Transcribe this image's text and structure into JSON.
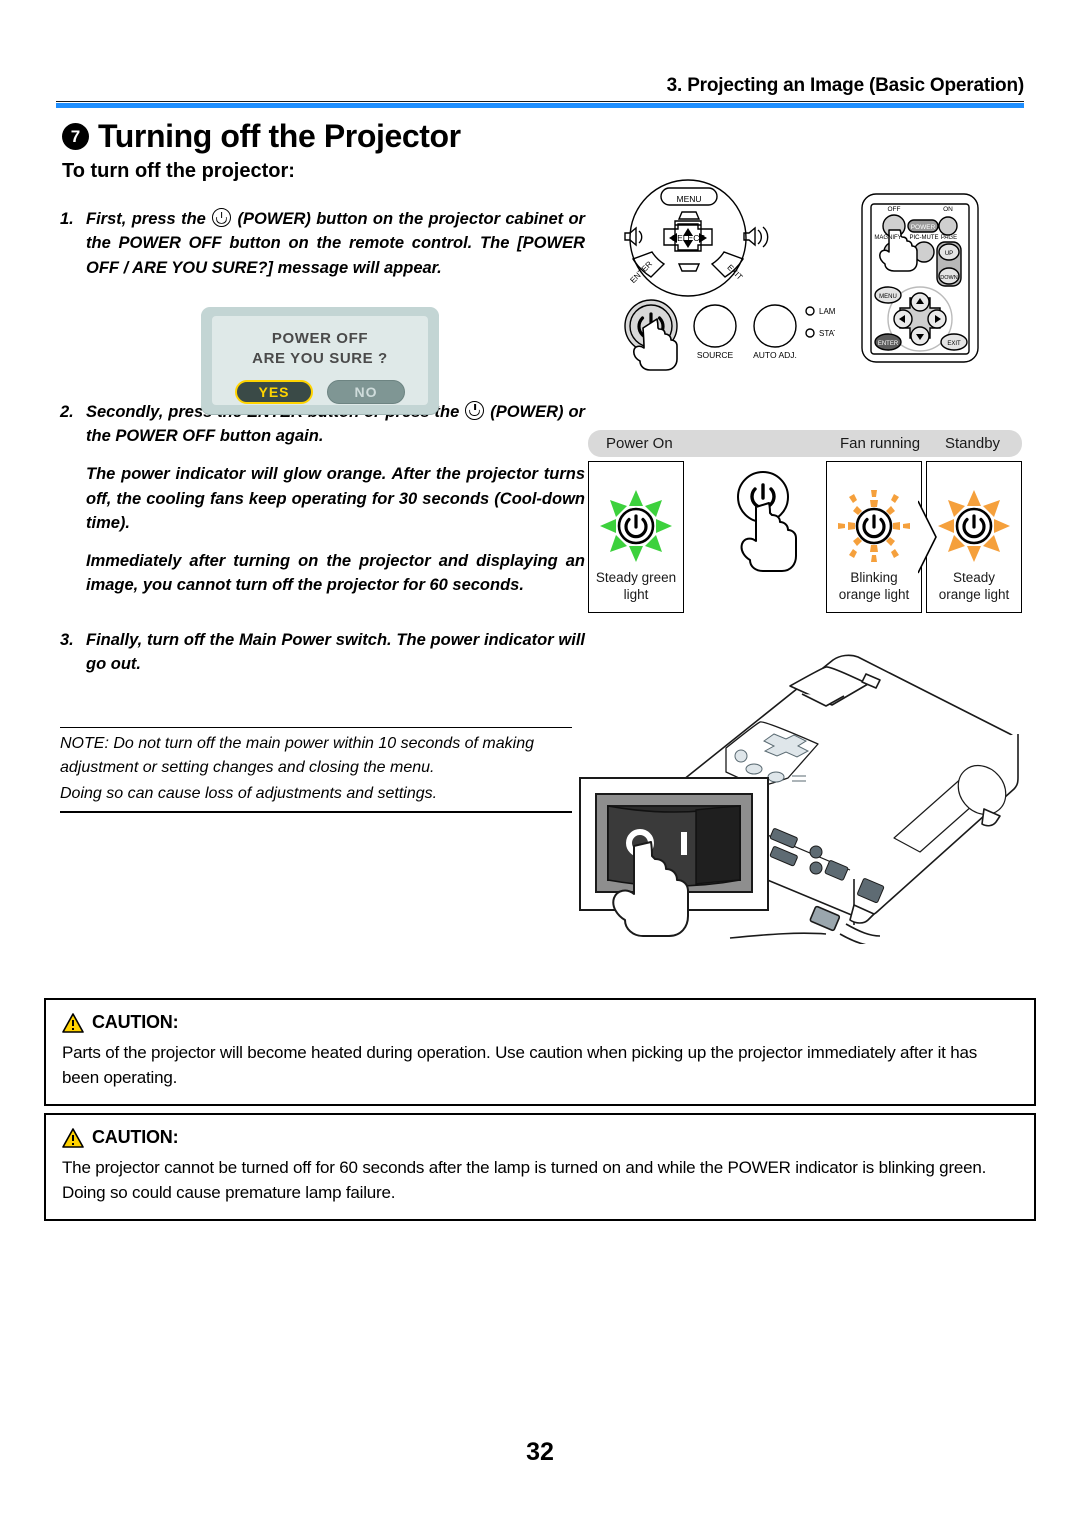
{
  "header": {
    "chapter_title": "3. Projecting an Image (Basic Operation)"
  },
  "section": {
    "number": "7",
    "title": "Turning off the Projector",
    "subhead": "To turn off the projector:"
  },
  "steps": [
    {
      "num": "1.",
      "text_before_icon": "First, press the",
      "icon": "power-icon",
      "text_after_icon": "(POWER) button on the projector cabinet or the POWER OFF button on the remote control. The [POWER OFF / ARE YOU SURE?] message will appear."
    },
    {
      "num": "2.",
      "text_before_icon": "Secondly, press the ENTER button or press the",
      "icon": "power-icon",
      "text_after_icon": "(POWER) or the POWER OFF button again."
    }
  ],
  "step2_paragraphs": [
    "The power indicator will glow orange. After the projector turns off, the cooling fans keep operating for 30 seconds (Cool-down time).",
    "Immediately after turning on the projector and displaying an image, you cannot turn off the projector for 60 seconds."
  ],
  "step3": {
    "num": "3.",
    "text": "Finally, turn off the Main Power switch. The power indicator will go out."
  },
  "note": {
    "line1": "NOTE: Do not turn off the main power within 10 seconds of making adjustment or setting changes and closing the menu.",
    "line2": "Doing so can cause loss of adjustments and settings."
  },
  "dialog": {
    "line1": "POWER OFF",
    "line2": "ARE YOU SURE ?",
    "yes": "YES",
    "no": "NO"
  },
  "control_panel": {
    "menu": "MENU",
    "select": "SELECT",
    "enter": "ENTER",
    "exit": "EXIT",
    "source": "SOURCE",
    "auto_adj": "AUTO ADJ.",
    "lamp": "LAMP",
    "status": "STATUS"
  },
  "remote": {
    "off": "OFF",
    "on": "ON",
    "power": "POWER",
    "magnify": "MAGNIFY",
    "pic_mute": "PIC-MUTE",
    "page": "PAGE",
    "up": "UP",
    "down": "DOWN",
    "menu": "MENU",
    "enter": "ENTER",
    "exit": "EXIT"
  },
  "indicators": {
    "bar_labels": {
      "power_on": "Power On",
      "fan_running": "Fan running",
      "standby": "Standby"
    },
    "states": [
      {
        "name": "steady-green",
        "caption_line1": "Steady green",
        "caption_line2": "light",
        "color": "#3dd13d"
      },
      {
        "name": "blinking-orange",
        "caption_line1": "Blinking",
        "caption_line2": "orange light",
        "color": "#f5a03c"
      },
      {
        "name": "steady-orange",
        "caption_line1": "Steady",
        "caption_line2": "orange light",
        "color": "#f5a03c"
      }
    ]
  },
  "main_power_switch": {
    "off_mark": "O",
    "on_mark": "I"
  },
  "cautions": [
    {
      "label": "CAUTION:",
      "body": "Parts of the projector will become heated during operation. Use caution when picking up the projector immediately after it has been operating."
    },
    {
      "label": "CAUTION:",
      "body": "The projector cannot be turned off for 60 seconds after the lamp is turned on and while the POWER indicator is blinking green. Doing so could cause premature lamp failure."
    }
  ],
  "page_number": "32",
  "colors": {
    "rule_blue": "#1f8fff",
    "caution_yellow": "#ffd200",
    "green_led": "#3dd13d",
    "orange_led": "#f5a03c",
    "yes_yellow": "#ffd400"
  }
}
